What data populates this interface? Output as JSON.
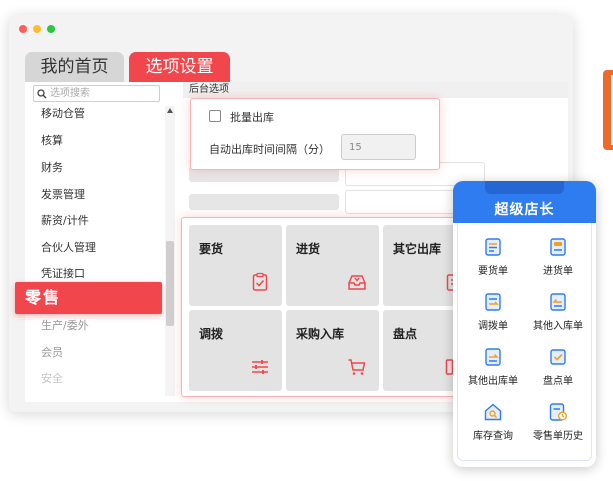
{
  "window": {
    "dot_colors": [
      "#fe5f57",
      "#febc2e",
      "#28c840"
    ]
  },
  "tabs": [
    {
      "label": "我的首页",
      "active": false
    },
    {
      "label": "选项设置",
      "active": true
    }
  ],
  "sidebar": {
    "search_placeholder": "选项搜索",
    "items": [
      {
        "label": "移动仓管"
      },
      {
        "label": "核算"
      },
      {
        "label": "财务"
      },
      {
        "label": "发票管理"
      },
      {
        "label": "薪资/计件"
      },
      {
        "label": "合伙人管理"
      },
      {
        "label": "凭证接口"
      },
      {
        "label": "零售",
        "active": true
      },
      {
        "label": "生产/委外"
      },
      {
        "label": "会员"
      },
      {
        "label": "安全"
      }
    ]
  },
  "content": {
    "header": "后台选项"
  },
  "popup": {
    "batch_checkbox_label": "批量出库",
    "batch_checked": false,
    "interval_label": "自动出库时间间隔（分）",
    "interval_value": "15"
  },
  "tiles": [
    {
      "label": "要货",
      "icon": "clipboard-check-icon"
    },
    {
      "label": "进货",
      "icon": "inbox-tray-icon"
    },
    {
      "label": "其它出库",
      "icon": "document-out-icon"
    },
    {
      "label": "调拨",
      "icon": "sliders-icon"
    },
    {
      "label": "采购入库",
      "icon": "cart-icon"
    },
    {
      "label": "盘点",
      "icon": "grid-icon"
    }
  ],
  "phone": {
    "title": "超级店长",
    "items": [
      {
        "label": "要货单",
        "icon": "list-document-icon"
      },
      {
        "label": "进货单",
        "icon": "tray-document-icon"
      },
      {
        "label": "调拨单",
        "icon": "transfer-document-icon"
      },
      {
        "label": "其他入库单",
        "icon": "inbound-document-icon"
      },
      {
        "label": "其他出库单",
        "icon": "outbound-document-icon"
      },
      {
        "label": "盘点单",
        "icon": "check-box-icon"
      },
      {
        "label": "库存查询",
        "icon": "house-search-icon"
      },
      {
        "label": "零售单历史",
        "icon": "history-document-icon"
      }
    ]
  },
  "colors": {
    "accent_red": "#f2464d",
    "phone_blue": "#2f7bf0",
    "orange_edge": "#ee6a2a"
  }
}
